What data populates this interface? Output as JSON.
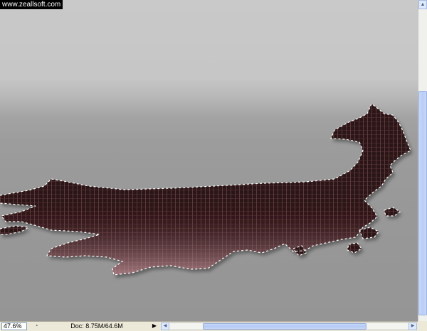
{
  "watermark": {
    "text": "www.zeallsoft.com"
  },
  "statusbar": {
    "zoom": "47.6%",
    "doc_info": "Doc: 8.75M/64.6M",
    "menu_arrow_icon": "triangle-right-icon",
    "nav_icon": "preview-nav-icon"
  },
  "canvas": {
    "selection": "marching-ants",
    "shape": "liquid-splash"
  },
  "colors": {
    "canvas_top": "#c9c9c9",
    "canvas_bottom": "#959595",
    "splash_dark": "#2c1214",
    "splash_highlight": "#c89aa0",
    "scroll_accent": "#b8cdf6"
  }
}
